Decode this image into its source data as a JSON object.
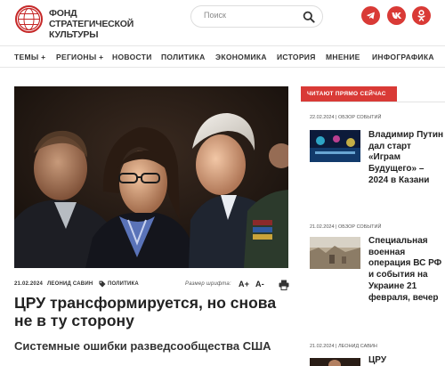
{
  "header": {
    "logo_text": "Фонд стратегической культуры",
    "search_placeholder": "Поиск",
    "social": [
      "telegram-icon",
      "vk-icon",
      "odnoklassniki-icon"
    ],
    "accent_color": "#d93a36"
  },
  "nav": {
    "items": [
      "ТЕМЫ +",
      "РЕГИОНЫ +",
      "НОВОСТИ",
      "ПОЛИТИКА",
      "ЭКОНОМИКА",
      "ИСТОРИЯ",
      "МНЕНИЕ",
      "ИНФОГРАФИКА"
    ]
  },
  "article": {
    "date": "21.02.2024",
    "author": "ЛЕОНИД САВИН",
    "category": "ПОЛИТИКА",
    "font_size_label": "Размер шрифта:",
    "font_increase": "A+",
    "font_decrease": "A-",
    "title": "ЦРУ трансформируется, но снова не в ту сторону",
    "subtitle": "Системные ошибки разведсообщества США"
  },
  "sidebar": {
    "heading": "ЧИТАЮТ ПРЯМО СЕЙЧАС",
    "items": [
      {
        "meta": "22.02.2024 | ОБЗОР СОБЫТИЙ",
        "title": "Владимир Путин дал старт «Играм Будущего» – 2024 в Казани"
      },
      {
        "meta": "21.02.2024 | ОБЗОР СОБЫТИЙ",
        "title": "Специальная военная операция ВС РФ и события на Украине 21 февраля, вечер"
      },
      {
        "meta": "21.02.2024 | ЛЕОНИД САВИН",
        "title": "ЦРУ"
      }
    ]
  }
}
